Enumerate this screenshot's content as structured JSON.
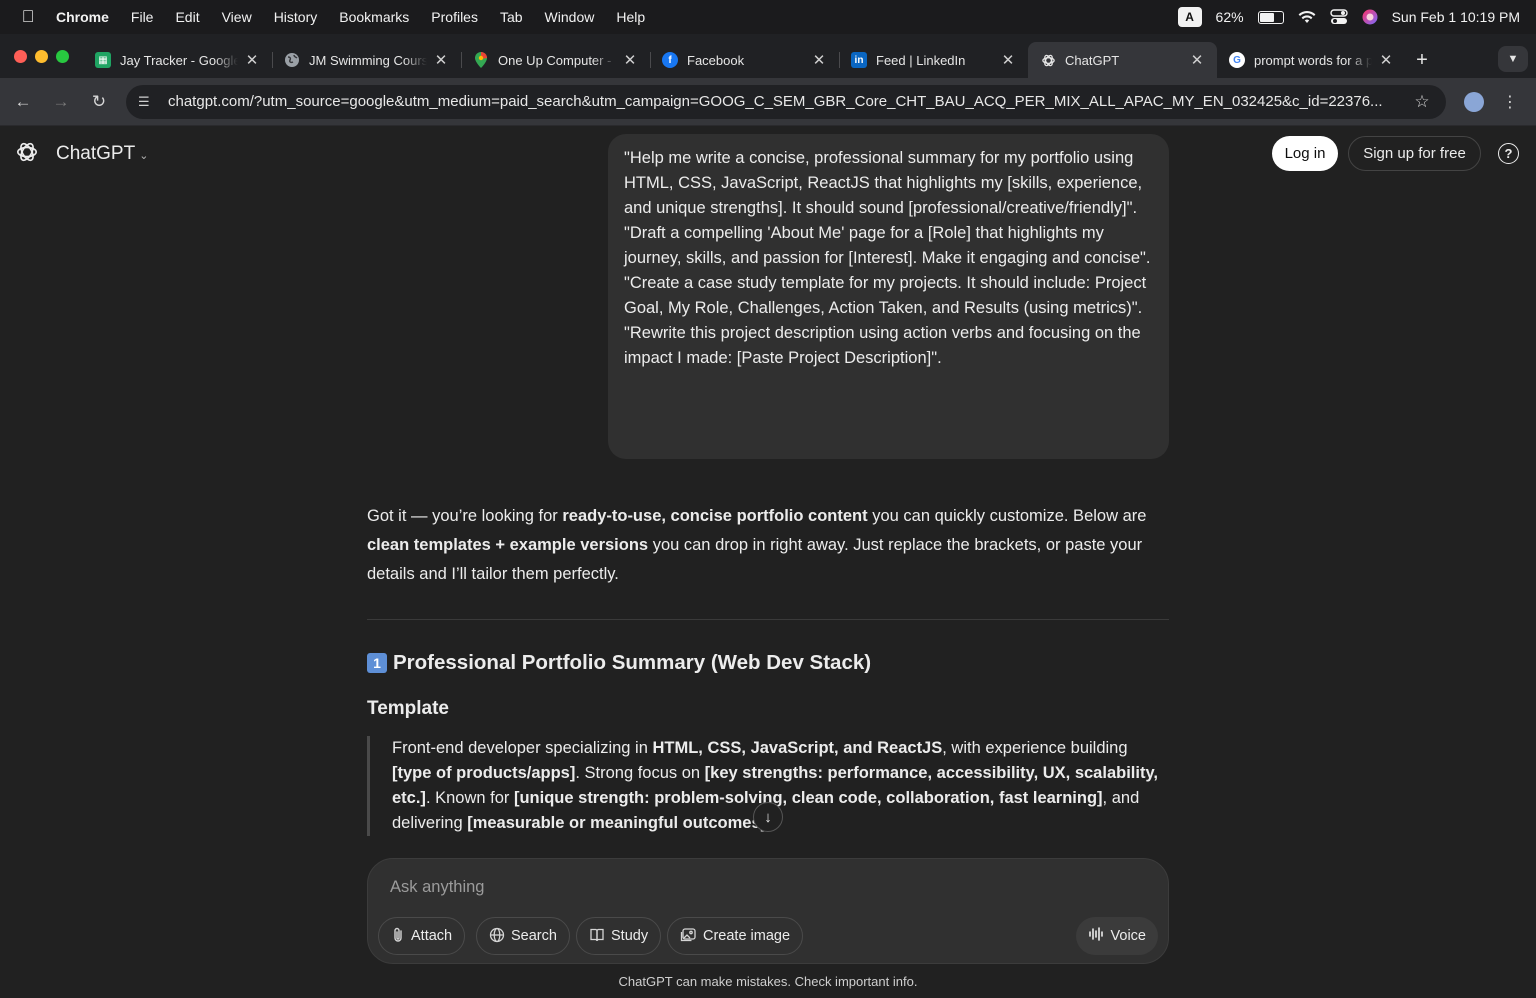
{
  "menubar": {
    "app_name": "Chrome",
    "items": [
      "File",
      "Edit",
      "View",
      "History",
      "Bookmarks",
      "Profiles",
      "Tab",
      "Window",
      "Help"
    ],
    "input_source": "A",
    "battery_percent": "62%",
    "battery_level": 0.62,
    "datetime": "Sun Feb 1  10:19 PM"
  },
  "tabs": [
    {
      "title": "Jay Tracker - Google Sheets",
      "icon": "sheets-icon",
      "color": "#1fa463"
    },
    {
      "title": "JM Swimming Courses",
      "icon": "globe-icon",
      "color": "#5f6368"
    },
    {
      "title": "One Up Computer - Google Maps",
      "icon": "maps-pin-icon",
      "color": "#ea4335"
    },
    {
      "title": "Facebook",
      "icon": "facebook-icon",
      "color": "#1877f2"
    },
    {
      "title": "Feed | LinkedIn",
      "icon": "linkedin-icon",
      "color": "#0a66c2"
    },
    {
      "title": "ChatGPT",
      "icon": "openai-icon",
      "color": "#ffffff",
      "active": true
    },
    {
      "title": "prompt words for a portfolio",
      "icon": "google-icon",
      "color": "#4285f4"
    }
  ],
  "toolbar": {
    "url": "chatgpt.com/?utm_source=google&utm_medium=paid_search&utm_campaign=GOOG_C_SEM_GBR_Core_CHT_BAU_ACQ_PER_MIX_ALL_APAC_MY_EN_032425&c_id=22376..."
  },
  "header": {
    "brand": "ChatGPT",
    "login_label": "Log in",
    "signup_label": "Sign up for free",
    "help_label": "?"
  },
  "user_message": [
    "\"Help me write a concise, professional summary for my portfolio using HTML, CSS, JavaScript, ReactJS that highlights my [skills, experience, and unique strengths]. It should sound [professional/creative/friendly]\".",
    "\"Draft a compelling 'About Me' page for a [Role] that highlights my journey, skills, and passion for [Interest]. Make it engaging and concise\".",
    "\"Create a case study template for my projects. It should include: Project Goal, My Role, Challenges, Action Taken, and Results (using metrics)\".",
    "\"Rewrite this project description using action verbs and focusing on the impact I made: [Paste Project Description]\"."
  ],
  "reply": {
    "intro_1": "Got it — you’re looking for ",
    "intro_bold_1": "ready-to-use, concise portfolio content",
    "intro_2": " you can quickly customize. Below are ",
    "intro_bold_2": "clean templates + example versions",
    "intro_3": " you can drop in right away. Just replace the brackets, or paste your details and I’ll tailor them perfectly.",
    "section_number": "1",
    "section_title": "Professional Portfolio Summary (Web Dev Stack)",
    "subheading": "Template",
    "quote_1": "Front-end developer specializing in ",
    "quote_bold_1": "HTML, CSS, JavaScript, and ReactJS",
    "quote_2": ", with experience building ",
    "quote_bold_2": "[type of products/apps]",
    "quote_3": ". Strong focus on ",
    "quote_bold_3": "[key strengths: performance, accessibility, UX, scalability, etc.]",
    "quote_4": ". Known for ",
    "quote_bold_4": "[unique strength: problem-solving, clean code, collaboration, fast learning]",
    "quote_5": ", and delivering ",
    "quote_bold_5": "[measurable or meaningful outcomes]",
    "quote_6": "."
  },
  "composer": {
    "placeholder": "Ask anything",
    "attach_label": "Attach",
    "search_label": "Search",
    "study_label": "Study",
    "create_image_label": "Create image",
    "voice_label": "Voice"
  },
  "footer": {
    "disclaimer": "ChatGPT can make mistakes. Check important info."
  }
}
